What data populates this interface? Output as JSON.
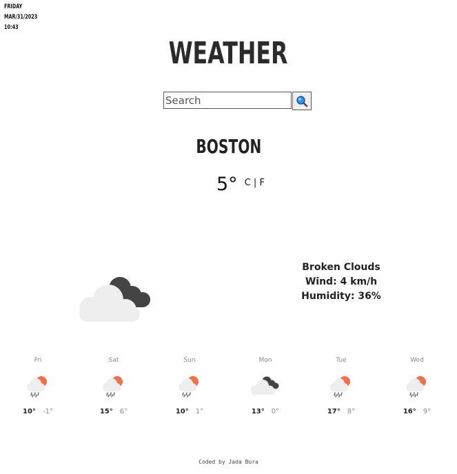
{
  "date": {
    "weekday": "Friday",
    "date": "Mar/31/2023",
    "time": "10:43"
  },
  "app_title": "Weather",
  "search": {
    "placeholder": "Search",
    "value": ""
  },
  "current": {
    "city": "Boston",
    "temperature": "5°",
    "unit_c": "C",
    "unit_sep": "|",
    "unit_f": "F",
    "description": "Broken Clouds",
    "wind": "Wind: 4 km/h",
    "humidity": "Humidity: 36%",
    "icon": "broken-clouds-icon"
  },
  "forecast": [
    {
      "day": "Fri",
      "high": "10°",
      "low": "-1°",
      "icon": "rain-sun-icon"
    },
    {
      "day": "Sat",
      "high": "15°",
      "low": "6°",
      "icon": "rain-sun-icon"
    },
    {
      "day": "Sun",
      "high": "10°",
      "low": "1°",
      "icon": "rain-sun-icon"
    },
    {
      "day": "Mon",
      "high": "13°",
      "low": "0°",
      "icon": "broken-clouds-icon"
    },
    {
      "day": "Tue",
      "high": "17°",
      "low": "8°",
      "icon": "rain-sun-icon"
    },
    {
      "day": "Wed",
      "high": "16°",
      "low": "9°",
      "icon": "rain-sun-icon"
    }
  ],
  "footer": "Coded by Jada Bura",
  "colors": {
    "sun": "#f0704a",
    "cloud_light": "#eeeeee",
    "cloud_dark": "#444444",
    "accent_search": "#1e88e5"
  }
}
